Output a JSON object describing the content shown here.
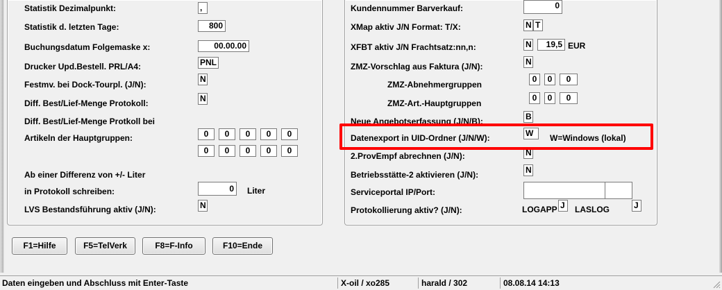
{
  "left_panel": {
    "rows": [
      {
        "label": "Statistik Dezimalpunkt:",
        "values": [
          ","
        ]
      },
      {
        "label": "Statistik d. letzten Tage:",
        "values": [
          "800"
        ]
      },
      {
        "label": "Buchungsdatum Folgemaske x:",
        "values": [
          "00.00.00"
        ]
      },
      {
        "label": "Drucker Upd.Bestell. PRL/A4:",
        "values": [
          "PNL"
        ]
      },
      {
        "label": "Festmv. bei Dock-Tourpl. (J/N):",
        "values": [
          "N"
        ]
      },
      {
        "label": "Diff. Best/Lief-Menge Protokoll:",
        "values": [
          "N"
        ]
      },
      {
        "label": "Diff. Best/Lief-Menge Protkoll bei",
        "values": []
      },
      {
        "label": "Artikeln der Hauptgruppen:",
        "values": [
          "0",
          "0",
          "0",
          "0",
          "0"
        ]
      },
      {
        "label": "",
        "values": [
          "0",
          "0",
          "0",
          "0",
          "0"
        ]
      },
      {
        "label": "Ab einer Differenz von +/- Liter",
        "values": []
      },
      {
        "label": "in Protokoll schreiben:",
        "values": [
          "0"
        ],
        "unit": "Liter"
      },
      {
        "label": "LVS Bestandsführung aktiv (J/N):",
        "values": [
          "N"
        ]
      }
    ]
  },
  "right_panel": {
    "rows": [
      {
        "label": "Kundennummer Barverkauf:",
        "values": [
          "0"
        ]
      },
      {
        "label": "XMap aktiv J/N  Format: T/X:",
        "values": [
          "N",
          "T"
        ]
      },
      {
        "label": "XFBT aktiv J/N  Frachtsatz:nn,n:",
        "values": [
          "N",
          "19,5"
        ],
        "unit": "EUR"
      },
      {
        "label": "ZMZ-Vorschlag aus Faktura (J/N):",
        "values": [
          "N"
        ]
      },
      {
        "label": "ZMZ-Abnehmergruppen",
        "values": [
          "0",
          "0",
          "0"
        ]
      },
      {
        "label": "ZMZ-Art.-Hauptgruppen",
        "values": [
          "0",
          "0",
          "0"
        ]
      },
      {
        "label": "Neue Angebotserfassung (J/N/B):",
        "values": [
          "B"
        ]
      },
      {
        "label": "Datenexport in UID-Ordner (J/N/W):",
        "values": [
          "W"
        ],
        "hint": "W=Windows (lokal)"
      },
      {
        "label": "2.ProvEmpf abrechnen (J/N):",
        "values": [
          "N"
        ]
      },
      {
        "label": "Betriebsstätte-2 aktivieren (J/N):",
        "values": [
          "N"
        ]
      },
      {
        "label": "Serviceportal IP/Port:",
        "values": [
          "",
          ""
        ]
      },
      {
        "label": "Protokollierung aktiv? (J/N):",
        "logapp_label": "LOGAPP",
        "logapp_value": "J",
        "laslog_label": "LASLOG",
        "laslog_value": "J"
      }
    ]
  },
  "buttons": {
    "help": "F1=Hilfe",
    "telverk": "F5=TelVerk",
    "finfo": "F8=F-Info",
    "end": "F10=Ende"
  },
  "statusbar": {
    "message": "Daten eingeben und Abschluss mit Enter-Taste",
    "system": "X-oil / xo285",
    "user": "harald / 302",
    "datetime": "08.08.14 14:13"
  },
  "colors": {
    "highlight": "#ff0000",
    "window_bg": "#f0f0f0"
  }
}
